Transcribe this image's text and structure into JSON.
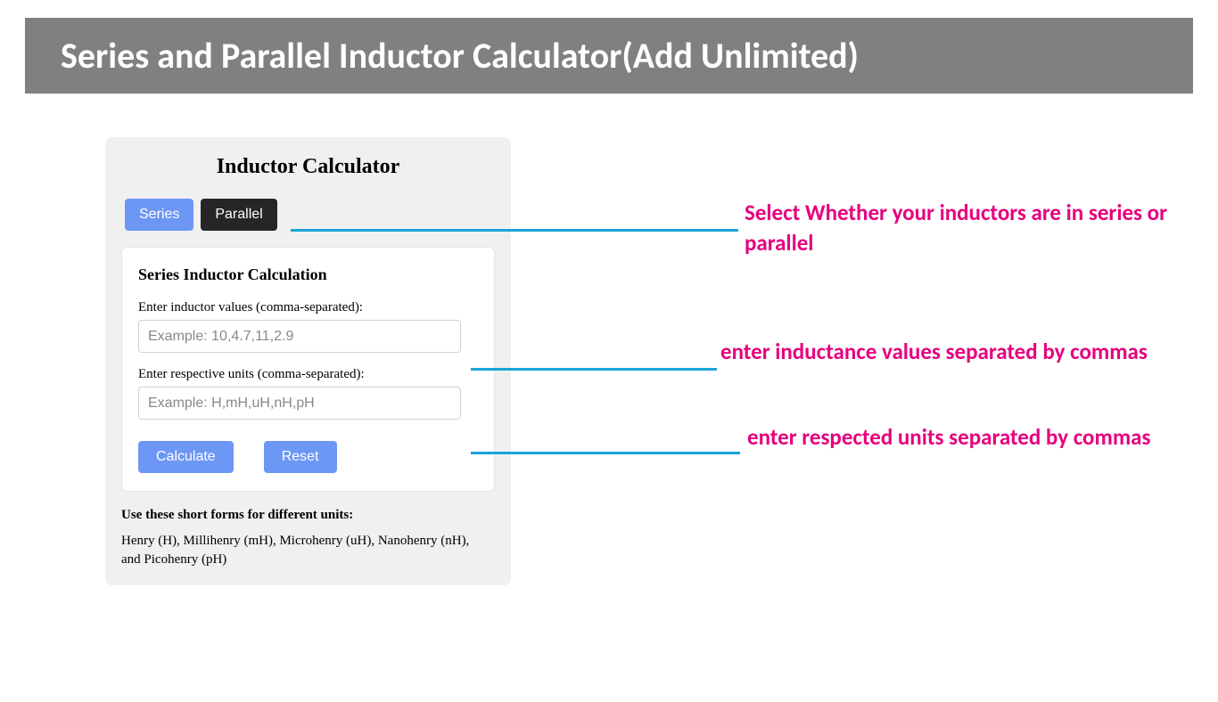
{
  "header": {
    "title": "Series and Parallel Inductor Calculator(Add Unlimited)"
  },
  "calc": {
    "title": "Inductor Calculator",
    "tabs": {
      "series": "Series",
      "parallel": "Parallel"
    },
    "form": {
      "heading": "Series Inductor Calculation",
      "values_label": "Enter inductor values (comma-separated):",
      "values_placeholder": "Example: 10,4.7,11,2.9",
      "values_value": "",
      "units_label": "Enter respective units (comma-separated):",
      "units_placeholder": "Example: H,mH,uH,nH,pH",
      "units_value": "",
      "calculate_label": "Calculate",
      "reset_label": "Reset"
    },
    "footer": {
      "bold": "Use these short forms for different units:",
      "text": "Henry (H), Millihenry (mH), Microhenry (uH), Nanohenry (nH), and Picohenry (pH)"
    }
  },
  "annotations": {
    "select_mode": "Select Whether your inductors are in series or parallel",
    "enter_values": "enter inductance values separated by commas",
    "enter_units": "enter respected units separated by commas"
  }
}
